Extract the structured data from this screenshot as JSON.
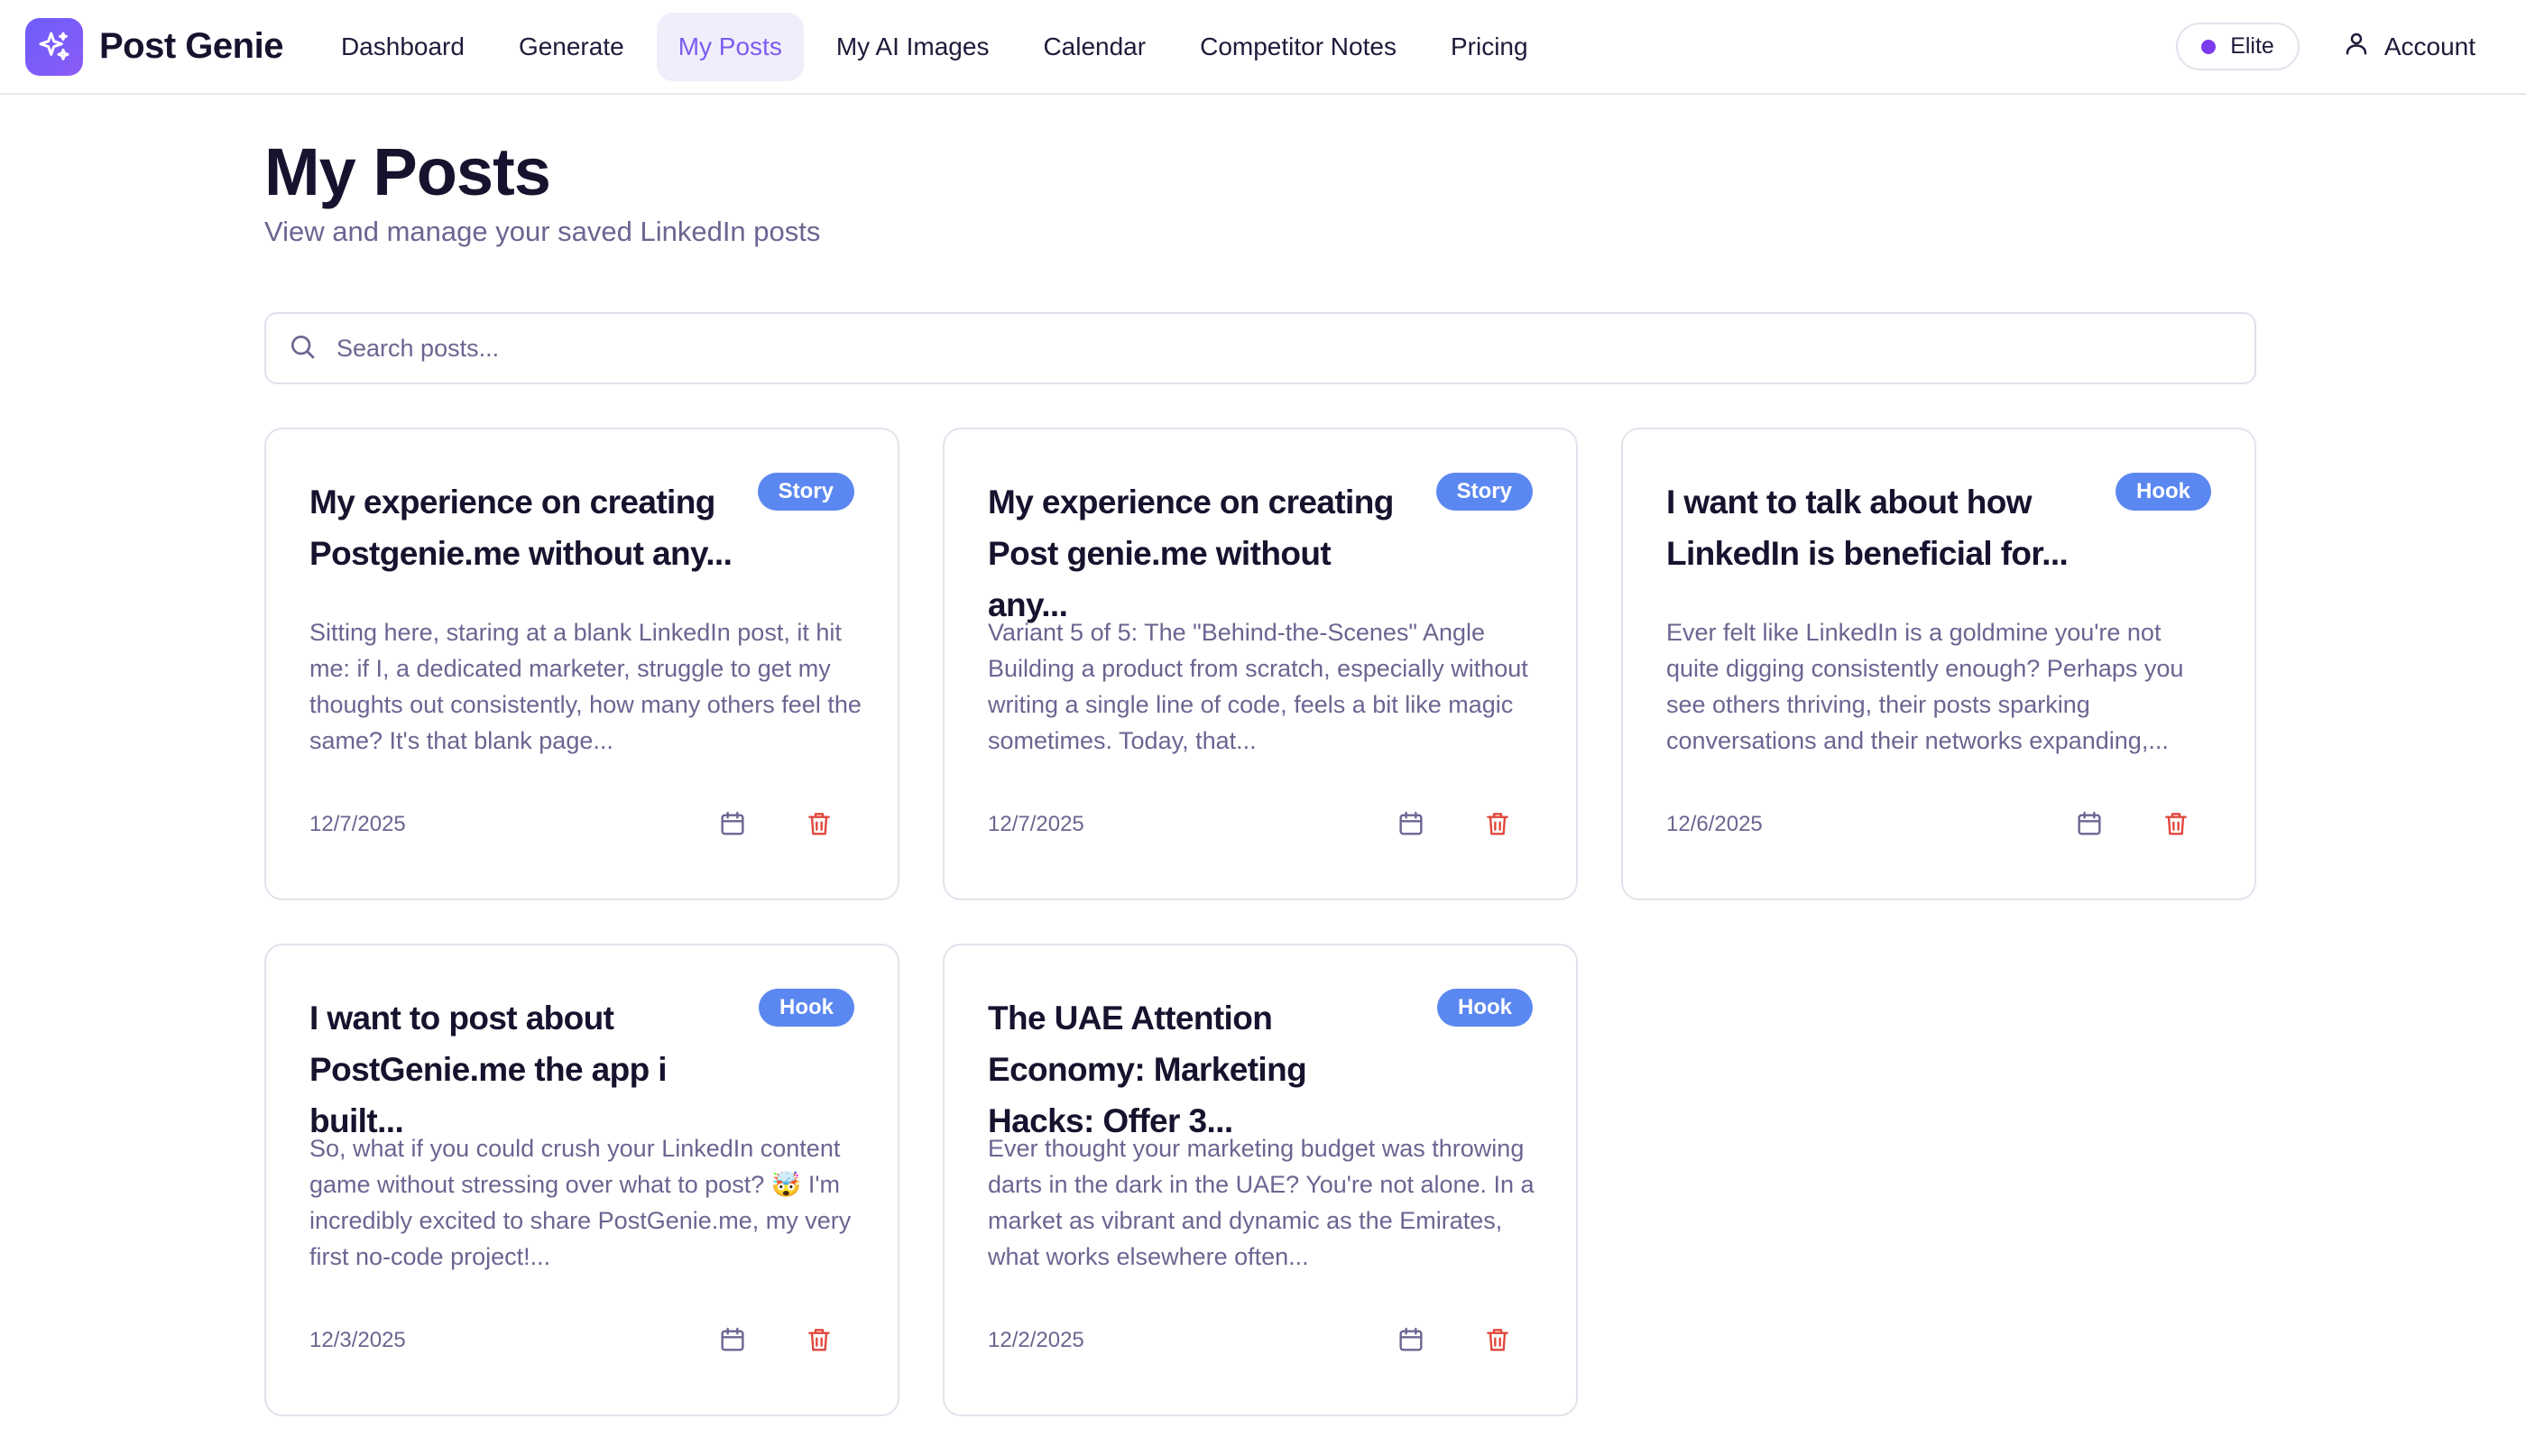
{
  "brand": {
    "name": "Post Genie",
    "logo_icon": "sparkle-icon",
    "accent": "#7c5cf0"
  },
  "nav": {
    "items": [
      {
        "label": "Dashboard"
      },
      {
        "label": "Generate"
      },
      {
        "label": "My Posts",
        "active": true
      },
      {
        "label": "My AI Images"
      },
      {
        "label": "Calendar"
      },
      {
        "label": "Competitor Notes"
      },
      {
        "label": "Pricing"
      }
    ],
    "plan_label": "Elite",
    "account_label": "Account"
  },
  "header": {
    "title": "My Posts",
    "subtitle": "View and manage your saved LinkedIn posts"
  },
  "search": {
    "placeholder": "Search posts...",
    "value": ""
  },
  "posts": [
    {
      "title": "My experience on creating Postgenie.me without any...",
      "tag": "Story",
      "excerpt": "Sitting here, staring at a blank LinkedIn post, it hit me: if I, a dedicated marketer, struggle to get my thoughts out consistently, how many others feel the same? It's that blank page...",
      "date": "12/7/2025"
    },
    {
      "title": "My experience on creating Post genie.me without any...",
      "tag": "Story",
      "excerpt": "Variant 5 of 5: The \"Behind-the-Scenes\" Angle Building a product from scratch, especially without writing a single line of code, feels a bit like magic sometimes. Today, that...",
      "date": "12/7/2025"
    },
    {
      "title": "I want to talk about how LinkedIn is beneficial for...",
      "tag": "Hook",
      "excerpt": "Ever felt like LinkedIn is a goldmine you're not quite digging consistently enough? Perhaps you see others thriving, their posts sparking conversations and their networks expanding,...",
      "date": "12/6/2025"
    },
    {
      "title": "I want to post about PostGenie.me the app i built...",
      "tag": "Hook",
      "excerpt": "So, what if you could crush your LinkedIn content game without stressing over what to post? 🤯 I'm incredibly excited to share PostGenie.me, my very first no-code project!...",
      "date": "12/3/2025"
    },
    {
      "title": "The UAE Attention Economy: Marketing Hacks: Offer 3...",
      "tag": "Hook",
      "excerpt": "Ever thought your marketing budget was throwing darts in the dark in the UAE? You're not alone. In a market as vibrant and dynamic as the Emirates, what works elsewhere often...",
      "date": "12/2/2025"
    }
  ],
  "colors": {
    "tag": "#5b87f0",
    "delete": "#e0473d",
    "muted_text": "#6b6591"
  }
}
